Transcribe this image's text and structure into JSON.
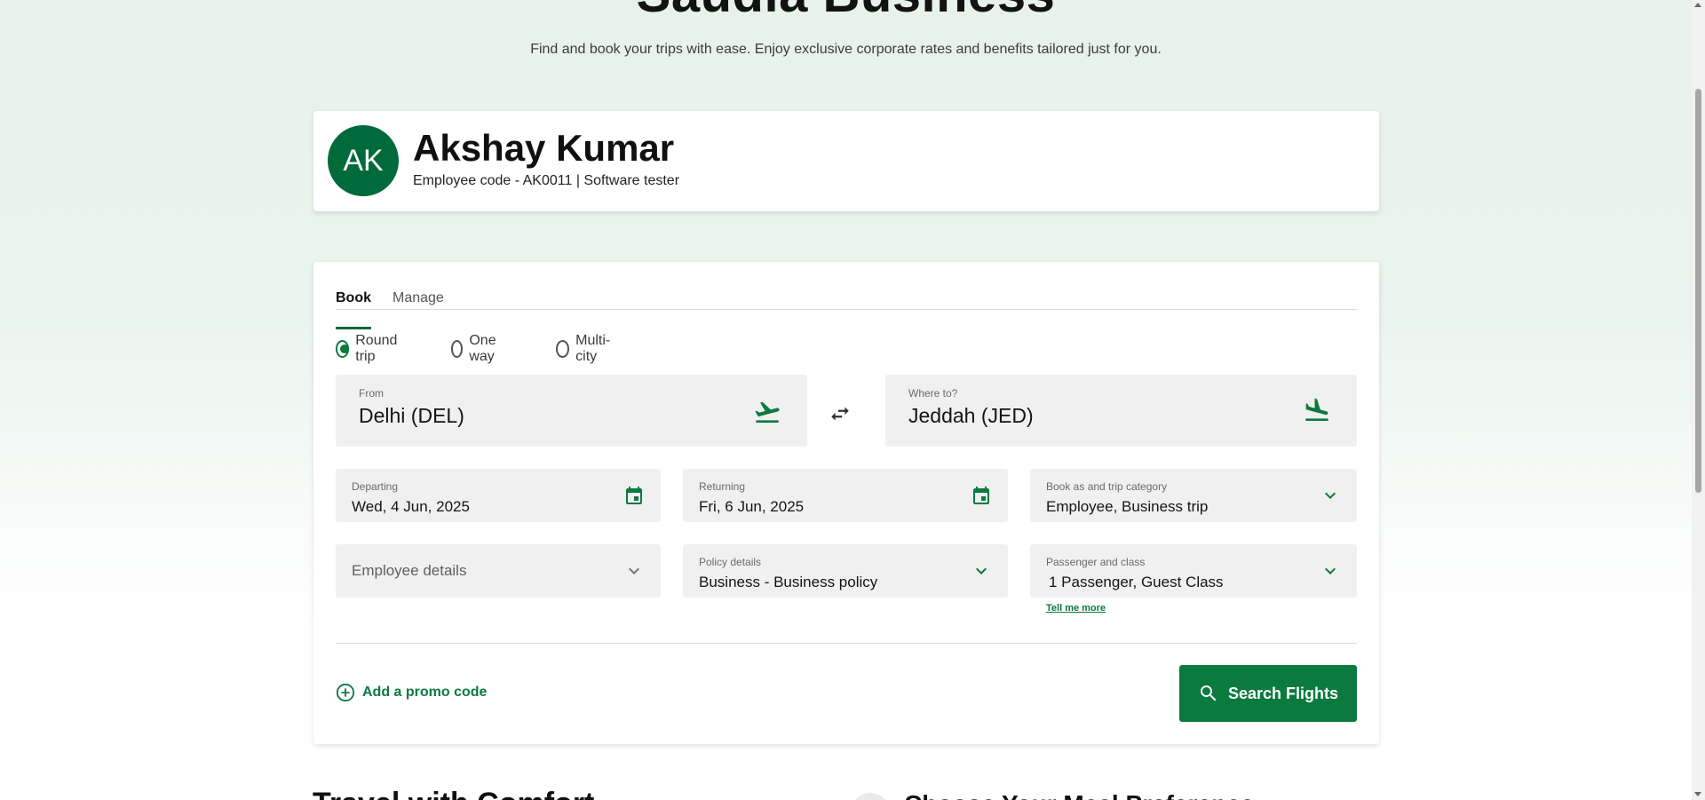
{
  "hero": {
    "title": "Saudia Business",
    "subtitle": "Find and book your trips with ease. Enjoy exclusive corporate rates and benefits tailored just for you."
  },
  "profile": {
    "initials": "AK",
    "name": "Akshay Kumar",
    "meta": "Employee code - AK0011 | Software tester"
  },
  "tabs": [
    {
      "label": "Book",
      "active": true
    },
    {
      "label": "Manage",
      "active": false
    }
  ],
  "trip_types": [
    {
      "label": "Round trip",
      "checked": true
    },
    {
      "label": "One way",
      "checked": false
    },
    {
      "label": "Multi-city",
      "checked": false
    }
  ],
  "from": {
    "label": "From",
    "value": "Delhi (DEL)",
    "icon": "takeoff-icon"
  },
  "to": {
    "label": "Where to?",
    "value": "Jeddah (JED)",
    "icon": "landing-icon"
  },
  "departing": {
    "label": "Departing",
    "value": "Wed, 4 Jun, 2025"
  },
  "returning": {
    "label": "Returning",
    "value": "Fri, 6 Jun, 2025"
  },
  "book_as": {
    "label": "Book as and trip category",
    "value": "Employee, Business trip"
  },
  "employee_details": {
    "placeholder": "Employee details"
  },
  "policy": {
    "label": "Policy details",
    "value": "Business - Business policy"
  },
  "passenger": {
    "label": "Passenger and class",
    "value": "1 Passenger, Guest Class"
  },
  "tell_more": "Tell me more",
  "promo": "Add a promo code",
  "search_button": "Search Flights",
  "sections": {
    "left_title": "Travel with Comfort",
    "right_title": "Choose Your Meal Preference"
  },
  "colors": {
    "brand_green": "#006a3a",
    "accent_green": "#0a7a3f",
    "field_bg": "#f0f0f0"
  }
}
